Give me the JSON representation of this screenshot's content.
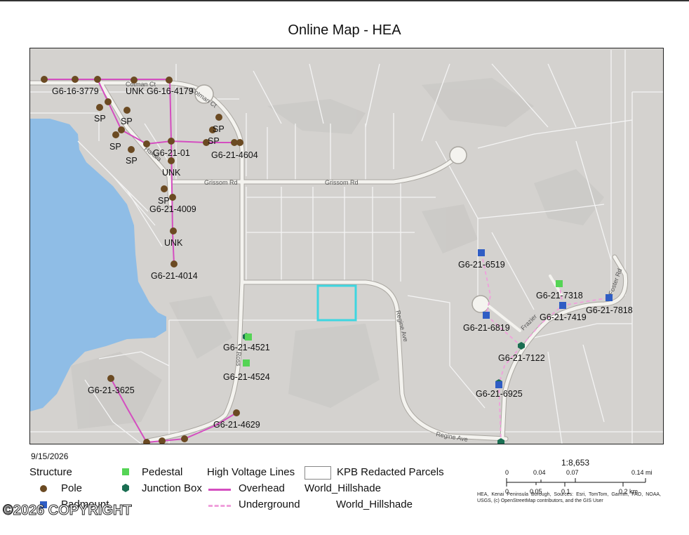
{
  "title": "Online Map - HEA",
  "date": "9/15/2026",
  "roads": [
    "Cotman Ct",
    "Cotman Ct",
    "Hakala",
    "Grissom Rd",
    "Grissom Rd",
    "Ross",
    "Regine Ave",
    "Regine Ave",
    "Frazier",
    "Foster Rd"
  ],
  "poles": [
    {
      "label": "G6-16-3779"
    },
    {
      "label": "UNK"
    },
    {
      "label": "G6-16-4179"
    },
    {
      "label": "SP"
    },
    {
      "label": "SP"
    },
    {
      "label": "SP"
    },
    {
      "label": "SP"
    },
    {
      "label": "SP"
    },
    {
      "label": "SP"
    },
    {
      "label": "G6-21-01"
    },
    {
      "label": "UNK"
    },
    {
      "label": "G6-21-4604"
    },
    {
      "label": "SP"
    },
    {
      "label": "G6-21-4009"
    },
    {
      "label": "UNK"
    },
    {
      "label": "G6-21-4014"
    },
    {
      "label": "G6-21-3625"
    },
    {
      "label": "G6-21-4629"
    }
  ],
  "pedestals": [
    "G6-21-4521",
    "G6-21-4524",
    "G6-21-7318"
  ],
  "padmounts": [
    "G6-21-6519",
    "G6-21-6819",
    "G6-21-7419",
    "G6-21-7818",
    "G6-21-6925"
  ],
  "junction_boxes": [
    "G6-21-7122"
  ],
  "legend": {
    "structure_header": "Structure",
    "pole": "Pole",
    "padmount": "Padmount",
    "pedestal": "Pedestal",
    "junction_box": "Junction Box",
    "hv_header": "High Voltage Lines",
    "overhead": "Overhead",
    "underground": "Underground",
    "parcels": "KPB Redacted Parcels",
    "hillshade_header": "World_Hillshade",
    "hillshade_item": "World_Hillshade"
  },
  "scale": {
    "ratio": "1:8,653",
    "mi_ticks": [
      "0",
      "0.04",
      "0.07",
      "0.14 mi"
    ],
    "km_ticks": [
      "0",
      "0.05",
      "0.1",
      "0.2 km"
    ]
  },
  "credits": "HEA, Kenai Peninsula Borough, Sources: Esri, TomTom, Garmin, FAO, NOAA, USGS, (c) OpenStreetMap contributors, and the GIS User",
  "copyright": "©2026 COPYRIGHT",
  "colors": {
    "water": "#8fbde6",
    "land": "#d4d2cf",
    "parcel_line": "#f4f4f4",
    "road": "#f2f1ec",
    "pole": "#6b4a22",
    "pedestal": "#55d455",
    "padmount": "#2f5dc4",
    "junction_box": "#1a6e52",
    "overhead": "#d44ec0",
    "underground": "#f0a0dc",
    "highlight": "#3ed6e0"
  }
}
